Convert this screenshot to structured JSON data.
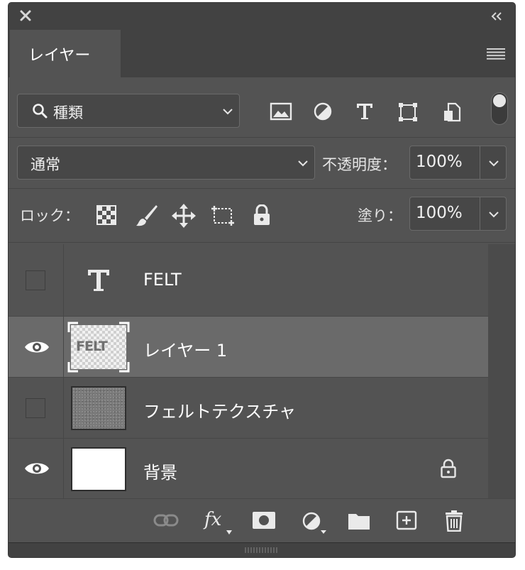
{
  "panel": {
    "tab_label": "レイヤー"
  },
  "filter": {
    "kind_label": "種類",
    "icons": [
      "image-filter-icon",
      "adjustment-filter-icon",
      "type-filter-icon",
      "shape-filter-icon",
      "smart-object-filter-icon"
    ]
  },
  "blend": {
    "mode": "通常",
    "opacity_label": "不透明度：",
    "opacity_value": "100%"
  },
  "lock": {
    "label": "ロック：",
    "fill_label": "塗り：",
    "fill_value": "100%"
  },
  "layers": [
    {
      "name": "FELT",
      "visible": false,
      "type": "text"
    },
    {
      "name": "レイヤー 1",
      "visible": true,
      "selected": true,
      "thumbnail_text": "FELT"
    },
    {
      "name": "フェルトテクスチャ",
      "visible": false
    },
    {
      "name": "背景",
      "visible": true,
      "locked": true
    }
  ],
  "bottom_icons": [
    "link-layers-icon",
    "fx-icon",
    "add-mask-icon",
    "new-adjustment-icon",
    "new-group-icon",
    "new-layer-icon",
    "delete-layer-icon"
  ],
  "bottom": {
    "fx_label": "fx"
  }
}
